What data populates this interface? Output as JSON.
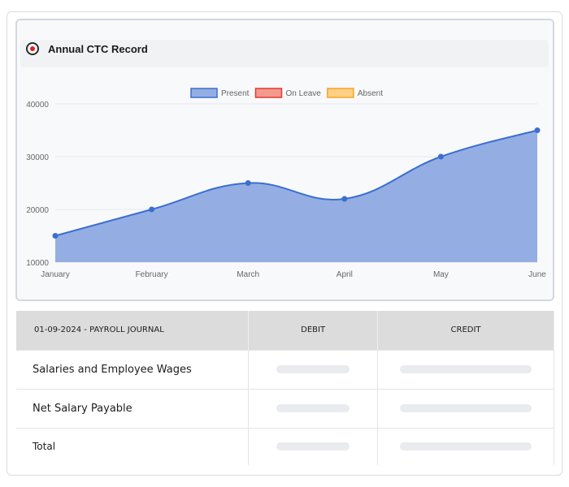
{
  "card": {
    "title": "Annual CTC Record"
  },
  "chart_data": {
    "type": "area",
    "title": "Annual CTC Record",
    "categories": [
      "January",
      "February",
      "March",
      "April",
      "May",
      "June"
    ],
    "series": [
      {
        "name": "Present",
        "values": [
          15000,
          20000,
          25000,
          22000,
          30000,
          35000
        ],
        "color": "#3a6fd0",
        "fill": "#94aee4"
      },
      {
        "name": "On Leave",
        "values": [],
        "color": "#e03b2c",
        "fill": "#f4998f"
      },
      {
        "name": "Absent",
        "values": [],
        "color": "#f4a425",
        "fill": "#ffcf84"
      }
    ],
    "y_ticks": [
      "40000",
      "30000",
      "20000",
      "10000"
    ],
    "ylim": [
      10000,
      40000
    ],
    "grid": true,
    "legend_position": "top"
  },
  "table": {
    "headers": [
      "01-09-2024 - PAYROLL JOURNAL",
      "DEBIT",
      "CREDIT"
    ],
    "rows": [
      {
        "label": "Salaries and Employee Wages"
      },
      {
        "label": "Net Salary Payable"
      },
      {
        "label": "Total"
      }
    ]
  }
}
